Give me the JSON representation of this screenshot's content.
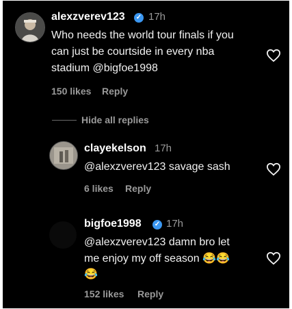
{
  "comment": {
    "username": "alexzverev123",
    "time": "17h",
    "text_lines": [
      "Who needs the world tour finals if you",
      "can just be courtside in every nba",
      "stadium @bigfoe1998"
    ],
    "likes": "150 likes",
    "reply_label": "Reply"
  },
  "hide_replies_label": "Hide all replies",
  "replies": [
    {
      "username": "clayekelson",
      "time": "17h",
      "text_lines": [
        "@alexzverev123 savage sash"
      ],
      "likes": "6 likes",
      "reply_label": "Reply"
    },
    {
      "username": "bigfoe1998",
      "time": "17h",
      "text_lines": [
        "@alexzverev123 damn bro let",
        "me enjoy my off season 😂😂",
        "😂"
      ],
      "likes": "152 likes",
      "reply_label": "Reply"
    }
  ],
  "icons": {
    "heart": "heart-outline-icon",
    "verified": "verified-badge-icon"
  },
  "colors": {
    "background": "#000000",
    "text": "#f2f2f2",
    "muted": "#9a9a9a",
    "verified": "#3b97f1"
  }
}
